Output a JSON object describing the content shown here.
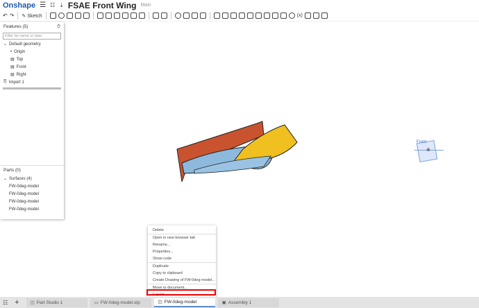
{
  "header": {
    "logo": "Onshape",
    "title": "FSAE Front Wing",
    "branch": "Main"
  },
  "toolbar": {
    "sketch_label": "Sketch"
  },
  "features": {
    "title": "Features (5)",
    "filter_placeholder": "Filter by name or type",
    "default_geometry": "Default geometry",
    "items": [
      "Origin",
      "Top",
      "Front",
      "Right"
    ],
    "import": "Import 1"
  },
  "parts": {
    "title": "Parts (0)",
    "surfaces": "Surfaces (4)",
    "items": [
      "FW-0deg-model",
      "FW-0deg-model",
      "FW-0deg-model",
      "FW-0deg-model"
    ]
  },
  "view_cube": {
    "label": "Front"
  },
  "context_menu": {
    "items": [
      "Delete",
      "Open in new browser tab",
      "Rename...",
      "Properties...",
      "Show code",
      "Duplicate",
      "Copy to clipboard",
      "Create Drawing of FW-0deg-model...",
      "Move to document...",
      "Export..."
    ]
  },
  "tabs": [
    {
      "label": "Part Studio 1"
    },
    {
      "label": "FW-0deg-model.stp"
    },
    {
      "label": "FW-0deg-model"
    },
    {
      "label": "Assembly 1"
    }
  ]
}
